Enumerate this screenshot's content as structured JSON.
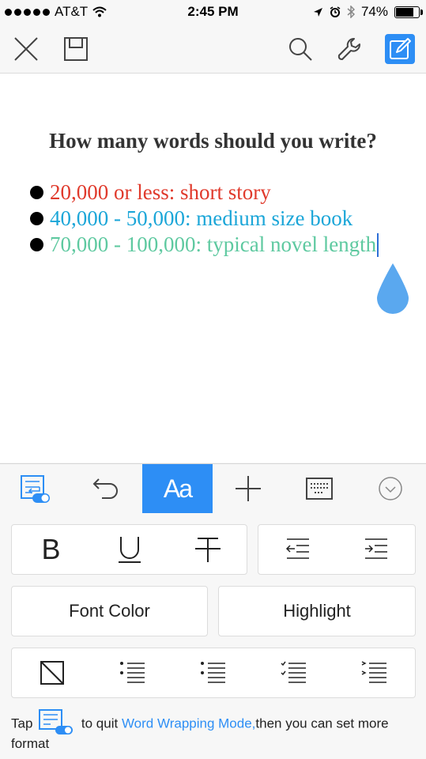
{
  "status_bar": {
    "carrier": "AT&T",
    "time": "2:45 PM",
    "battery": "74%",
    "battery_level": 0.74
  },
  "toolbar": {
    "icons": [
      "close-icon",
      "save-icon",
      "search-icon",
      "wrench-icon",
      "edit-icon"
    ]
  },
  "document": {
    "title": "How many words should you write?",
    "bullets": [
      {
        "text": "20,000 or less: short story",
        "color": "#e03a2c"
      },
      {
        "text": "40,000 - 50,000: medium size book",
        "color": "#1ba6d8"
      },
      {
        "text": "70,000 - 100,000: typical novel length",
        "color": "#5ec9a0"
      }
    ]
  },
  "format_bar": {
    "active_tab": "Aa",
    "font_tab_label": "Aa",
    "accent": "#2d8ef5"
  },
  "format_panel": {
    "style_buttons": [
      "B",
      "U",
      "T"
    ],
    "font_color_label": "Font Color",
    "highlight_label": "Highlight"
  },
  "hint": {
    "tap": "Tap",
    "middle": "to quit",
    "mode": "Word Wrapping Mode,",
    "rest": "then you can set more format"
  }
}
